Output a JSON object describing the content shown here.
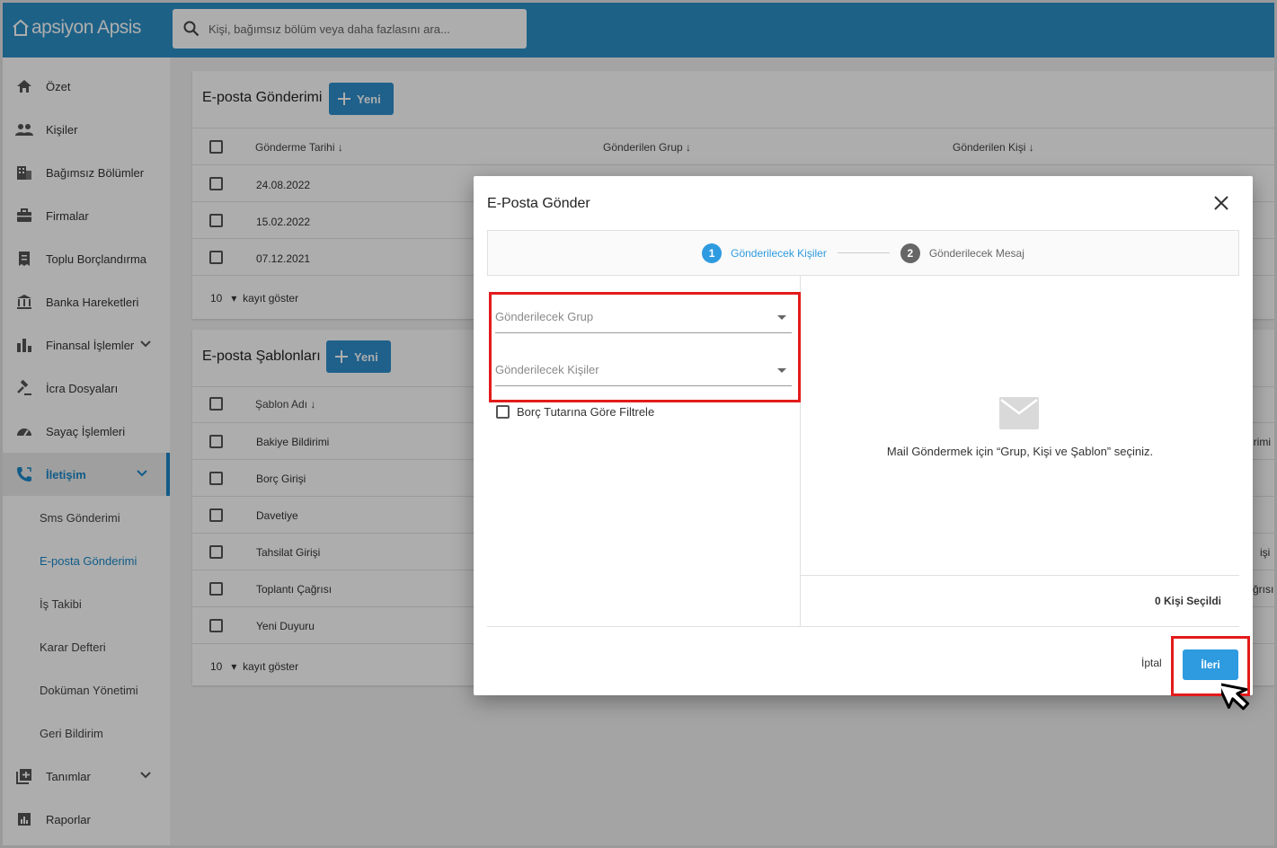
{
  "app": {
    "logo_text": "apsiyon Apsis"
  },
  "search": {
    "placeholder": "Kişi, bağımsız bölüm veya daha fazlasını ara..."
  },
  "sidebar": {
    "items": [
      {
        "label": "Özet",
        "icon": "home-icon"
      },
      {
        "label": "Kişiler",
        "icon": "people-icon"
      },
      {
        "label": "Bağımsız Bölümler",
        "icon": "building-icon"
      },
      {
        "label": "Firmalar",
        "icon": "briefcase-icon"
      },
      {
        "label": "Toplu Borçlandırma",
        "icon": "receipt-icon"
      },
      {
        "label": "Banka Hareketleri",
        "icon": "bank-icon"
      },
      {
        "label": "Finansal İşlemler",
        "icon": "bar-chart-icon"
      },
      {
        "label": "İcra Dosyaları",
        "icon": "gavel-icon"
      },
      {
        "label": "Sayaç İşlemleri",
        "icon": "gauge-icon"
      },
      {
        "label": "İletişim",
        "icon": "phone-icon"
      }
    ],
    "sub_items": [
      "Sms Gönderimi",
      "E-posta Gönderimi",
      "İş Takibi",
      "Karar Defteri",
      "Doküman Yönetimi",
      "Geri Bildirim"
    ],
    "bottom_items": [
      {
        "label": "Tanımlar",
        "icon": "library-add-icon"
      },
      {
        "label": "Raporlar",
        "icon": "report-icon"
      }
    ]
  },
  "email_card": {
    "title": "E-posta Gönderimi",
    "new_label": "Yeni",
    "columns": [
      "Gönderme Tarihi",
      "Gönderilen Grup",
      "Gönderilen Kişi"
    ],
    "rows": [
      "24.08.2022",
      "15.02.2022",
      "07.12.2021"
    ],
    "page_size": "10",
    "page_size_label": "kayıt göster"
  },
  "template_card": {
    "title": "E-posta Şablonları",
    "new_label": "Yeni",
    "columns": [
      "Şablon Adı"
    ],
    "rows": [
      "Bakiye Bildirimi",
      "Borç Girişi",
      "Davetiye",
      "Tahsilat Girişi",
      "Toplantı Çağrısı",
      "Yeni Duyuru"
    ],
    "page_size": "10",
    "page_size_label": "kayıt göster",
    "edge_text": [
      "irimi",
      "işi",
      "ğrısı"
    ]
  },
  "dialog": {
    "title": "E-Posta Gönder",
    "steps": [
      {
        "num": "1",
        "label": "Gönderilecek Kişiler"
      },
      {
        "num": "2",
        "label": "Gönderilecek Mesaj"
      }
    ],
    "group_placeholder": "Gönderilecek Grup",
    "people_placeholder": "Gönderilecek Kişiler",
    "filter_label": "Borç Tutarına Göre Filtrele",
    "empty_message": "Mail Göndermek için “Grup, Kişi ve Şablon” seçiniz.",
    "selected_count": "0 Kişi Seçildi",
    "cancel_label": "İptal",
    "next_label": "İleri"
  },
  "colors": {
    "header": "#2b8fc8",
    "accent": "#1a88c9",
    "highlight": "#e31b1b"
  }
}
